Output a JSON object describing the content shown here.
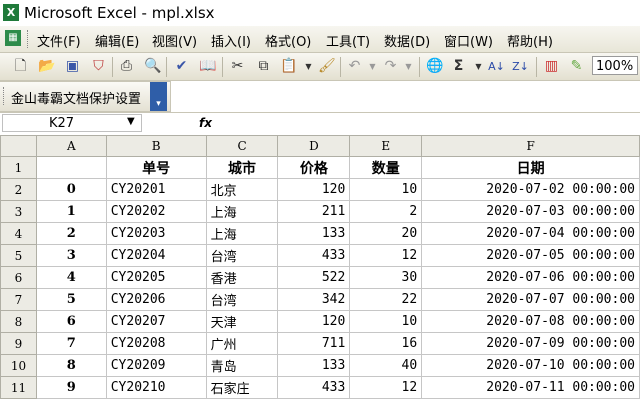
{
  "window": {
    "title": "Microsoft Excel - mpl.xlsx"
  },
  "menu": [
    "文件(F)",
    "编辑(E)",
    "视图(V)",
    "插入(I)",
    "格式(O)",
    "工具(T)",
    "数据(D)",
    "窗口(W)",
    "帮助(H)"
  ],
  "toolbar": {
    "icons": [
      "new-icon",
      "open-icon",
      "save-icon",
      "permission-icon",
      "print-icon",
      "print-preview-icon",
      "spelling-icon",
      "research-icon",
      "cut-icon",
      "copy-icon",
      "paste-icon",
      "format-painter-icon",
      "undo-icon",
      "redo-icon",
      "hyperlink-icon",
      "autosum-icon",
      "sort-ascending-icon",
      "sort-descending-icon",
      "chart-wizard-icon",
      "drawing-icon"
    ],
    "zoom": "100%"
  },
  "addin_toolbar": {
    "label": "金山毒霸文档保护设置"
  },
  "formula_bar": {
    "name_box": "K27",
    "fx": "fx"
  },
  "sheet": {
    "col_headers": [
      "A",
      "B",
      "C",
      "D",
      "E",
      "F"
    ],
    "header_row": {
      "row": "1",
      "cells": [
        "",
        "单号",
        "城市",
        "价格",
        "数量",
        "日期"
      ]
    },
    "rows": [
      {
        "row": "2",
        "idx": "0",
        "id": "CY20201",
        "city": "北京",
        "price": "120",
        "qty": "10",
        "date": "2020-07-02  00:00:00"
      },
      {
        "row": "3",
        "idx": "1",
        "id": "CY20202",
        "city": "上海",
        "price": "211",
        "qty": "2",
        "date": "2020-07-03  00:00:00"
      },
      {
        "row": "4",
        "idx": "2",
        "id": "CY20203",
        "city": "上海",
        "price": "133",
        "qty": "20",
        "date": "2020-07-04  00:00:00"
      },
      {
        "row": "5",
        "idx": "3",
        "id": "CY20204",
        "city": "台湾",
        "price": "433",
        "qty": "12",
        "date": "2020-07-05  00:00:00"
      },
      {
        "row": "6",
        "idx": "4",
        "id": "CY20205",
        "city": "香港",
        "price": "522",
        "qty": "30",
        "date": "2020-07-06  00:00:00"
      },
      {
        "row": "7",
        "idx": "5",
        "id": "CY20206",
        "city": "台湾",
        "price": "342",
        "qty": "22",
        "date": "2020-07-07  00:00:00"
      },
      {
        "row": "8",
        "idx": "6",
        "id": "CY20207",
        "city": "天津",
        "price": "120",
        "qty": "10",
        "date": "2020-07-08  00:00:00"
      },
      {
        "row": "9",
        "idx": "7",
        "id": "CY20208",
        "city": "广州",
        "price": "711",
        "qty": "16",
        "date": "2020-07-09  00:00:00"
      },
      {
        "row": "10",
        "idx": "8",
        "id": "CY20209",
        "city": "青岛",
        "price": "133",
        "qty": "40",
        "date": "2020-07-10  00:00:00"
      },
      {
        "row": "11",
        "idx": "9",
        "id": "CY20210",
        "city": "石家庄",
        "price": "433",
        "qty": "12",
        "date": "2020-07-11  00:00:00"
      }
    ]
  }
}
